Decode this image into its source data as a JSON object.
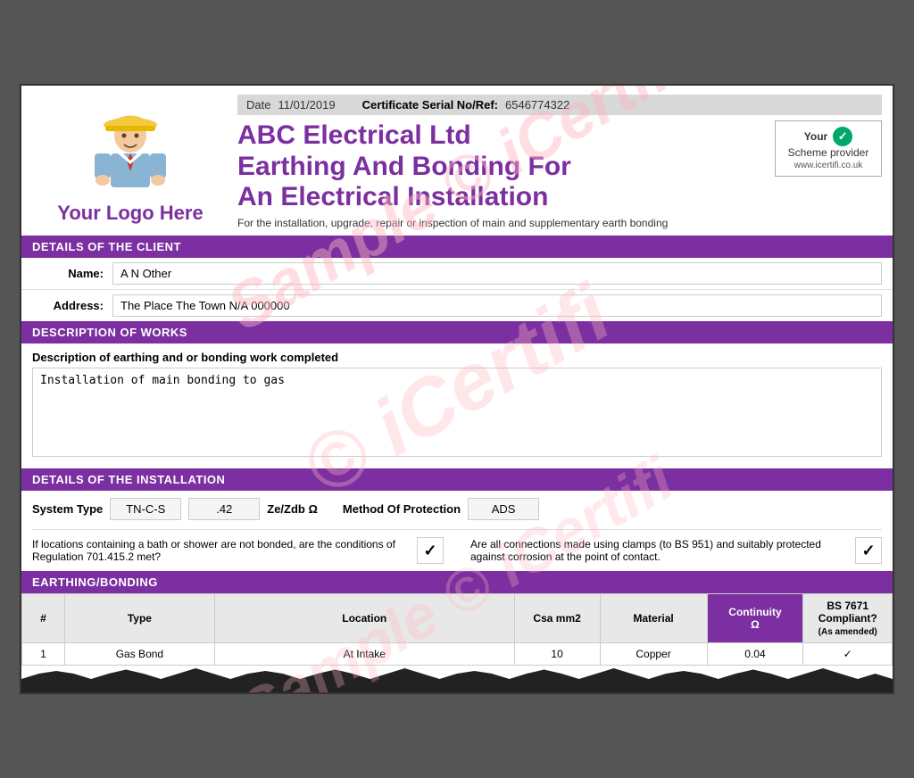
{
  "header": {
    "date_label": "Date",
    "date_value": "11/01/2019",
    "serial_label": "Certificate Serial No/Ref:",
    "serial_value": "6546774322",
    "company_name": "ABC  Electrical Ltd",
    "title_line2": "Earthing And Bonding For",
    "title_line3": "An Electrical Installation",
    "subtitle": "For the installation, upgrade, repair or inspection of main and supplementary earth bonding",
    "logo_text": "Your Logo Here",
    "scheme_your": "Your",
    "scheme_provider": "Scheme provider",
    "scheme_url": "www.icertifi.co.uk"
  },
  "sections": {
    "client_title": "DETAILS OF THE CLIENT",
    "works_title": "DESCRIPTION OF WORKS",
    "install_title": "DETAILS OF THE INSTALLATION",
    "eb_title": "EARTHING/BONDING"
  },
  "client": {
    "name_label": "Name:",
    "name_value": "A N Other",
    "address_label": "Address:",
    "address_value": "The Place  The Town N/A  000000"
  },
  "works": {
    "desc_label": "Description of earthing and or bonding work completed",
    "desc_value": "Installation of main bonding to gas"
  },
  "installation": {
    "system_type_label": "System Type",
    "system_type_value": "TN-C-S",
    "ze_zdb_value": ".42",
    "ze_zdb_label": "Ze/Zdb Ω",
    "method_label": "Method Of Protection",
    "method_value": "ADS",
    "q1_text": "If locations containing a bath or shower are not bonded, are the conditions of Regulation 701.415.2  met?",
    "q1_check": "✓",
    "q2_text": "Are all connections made using clamps (to BS 951) and  suitably protected against corrosion at the point of contact.",
    "q2_check": "✓"
  },
  "earthing_table": {
    "headers": {
      "hash": "#",
      "type": "Type",
      "location": "Location",
      "csa": "Csa mm2",
      "material": "Material",
      "continuity": "Continuity\nΩ",
      "bs": "BS 7671\nCompliant?\n(As amended)"
    },
    "rows": [
      {
        "hash": "1",
        "type": "Gas Bond",
        "location": "At Intake",
        "csa": "10",
        "material": "Copper",
        "continuity": "0.04",
        "bs": "✓"
      }
    ]
  },
  "watermark": {
    "lines": [
      "Sample © iCertifi",
      "© iCertifi",
      "Sample © iCertifi"
    ]
  }
}
